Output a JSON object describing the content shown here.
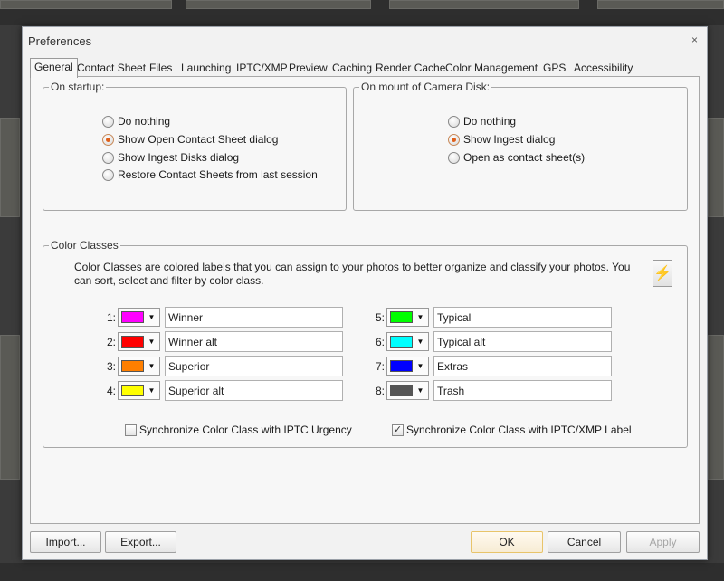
{
  "window": {
    "title": "Preferences",
    "close_label": "×"
  },
  "tabs": [
    {
      "label": "General"
    },
    {
      "label": "Contact Sheet"
    },
    {
      "label": "Files"
    },
    {
      "label": "Launching"
    },
    {
      "label": "IPTC/XMP"
    },
    {
      "label": "Preview"
    },
    {
      "label": "Caching"
    },
    {
      "label": "Render Cache"
    },
    {
      "label": "Color Management"
    },
    {
      "label": "GPS"
    },
    {
      "label": "Accessibility"
    }
  ],
  "startup": {
    "label": "On startup:",
    "options": [
      {
        "label": "Do nothing",
        "checked": false
      },
      {
        "label": "Show Open Contact Sheet dialog",
        "checked": true
      },
      {
        "label": "Show Ingest Disks dialog",
        "checked": false
      },
      {
        "label": "Restore Contact Sheets from last session",
        "checked": false
      }
    ]
  },
  "mount": {
    "label": "On mount of Camera Disk:",
    "options": [
      {
        "label": "Do nothing",
        "checked": false
      },
      {
        "label": "Show Ingest dialog",
        "checked": true
      },
      {
        "label": "Open as contact sheet(s)",
        "checked": false
      }
    ]
  },
  "color_classes": {
    "label": "Color Classes",
    "description": "Color Classes are colored labels that you can assign to your photos to better organize and classify your photos.  You can sort, select and filter by color class.",
    "flash_icon": "⚡",
    "items": [
      {
        "num": "1:",
        "color": "#ff00ff",
        "name": "Winner"
      },
      {
        "num": "2:",
        "color": "#ff0000",
        "name": "Winner alt"
      },
      {
        "num": "3:",
        "color": "#ff7f00",
        "name": "Superior"
      },
      {
        "num": "4:",
        "color": "#ffff00",
        "name": "Superior alt"
      },
      {
        "num": "5:",
        "color": "#00ff00",
        "name": "Typical"
      },
      {
        "num": "6:",
        "color": "#00ffff",
        "name": "Typical alt"
      },
      {
        "num": "7:",
        "color": "#0000ff",
        "name": "Extras"
      },
      {
        "num": "8:",
        "color": "#555555",
        "name": "Trash"
      }
    ],
    "sync_iptc_urgency": {
      "label": "Synchronize Color Class with IPTC Urgency",
      "checked": false
    },
    "sync_xmp_label": {
      "label": "Synchronize Color Class with IPTC/XMP Label",
      "checked": true
    }
  },
  "buttons": {
    "import": "Import...",
    "export": "Export...",
    "ok": "OK",
    "cancel": "Cancel",
    "apply": "Apply"
  }
}
